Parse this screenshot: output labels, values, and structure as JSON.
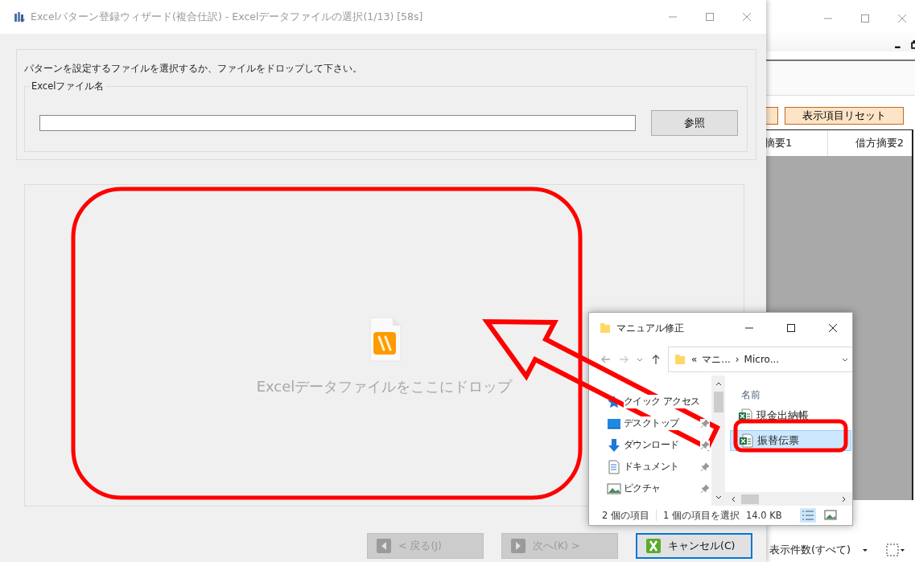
{
  "background_window": {
    "reset_button": "表示項目リセット",
    "columns": [
      "摘要1",
      "借方摘要2"
    ],
    "display_count": "表示件数(すべて)"
  },
  "wizard": {
    "title": "Excelパターン登録ウィザード(複合仕訳) - Excelデータファイルの選択(1/13) [58s]",
    "instruction": "パターンを設定するファイルを選択するか、ファイルをドロップして下さい。",
    "file_group_label": "Excelファイル名",
    "browse_button": "参照",
    "drop_hint": "Excelデータファイルをここにドロップ",
    "buttons": [
      {
        "kind": "back",
        "label": "< 戻る(J)",
        "disabled": true
      },
      {
        "kind": "next",
        "label": "次へ(K) >",
        "disabled": true
      },
      {
        "kind": "cancel",
        "label": "キャンセル(C)",
        "disabled": false
      }
    ]
  },
  "explorer": {
    "title": "マニュアル修正",
    "path": {
      "prefix": "«",
      "separator": "›",
      "segments": [
        "マニ...",
        "Micro..."
      ]
    },
    "nav_items": [
      {
        "kind": "star",
        "label": "クイック アクセス",
        "pinned": false
      },
      {
        "kind": "desktop",
        "label": "デスクトップ",
        "pinned": true
      },
      {
        "kind": "download",
        "label": "ダウンロード",
        "pinned": true
      },
      {
        "kind": "document",
        "label": "ドキュメント",
        "pinned": true
      },
      {
        "kind": "pictures",
        "label": "ピクチャ",
        "pinned": true
      }
    ],
    "column_header": "名前",
    "files": [
      {
        "name": "現金出納帳",
        "selected": false
      },
      {
        "name": "振替伝票",
        "selected": true
      }
    ],
    "status": {
      "items": "2 個の項目",
      "selection": "1 個の項目を選択",
      "size": "14.0 KB"
    }
  }
}
